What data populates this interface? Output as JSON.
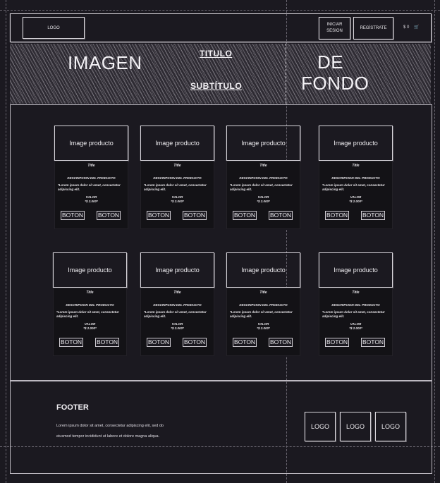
{
  "navbar": {
    "logo": "LOGO",
    "login_label": "INICIAR SESION",
    "register_label": "REGÍSTRATE",
    "cart_text": "$ 0"
  },
  "hero": {
    "left_text": "IMAGEN",
    "right_text_line1": "DE",
    "right_text_line2": "FONDO",
    "title": "TITULO",
    "subtitle": "SUBTÍTULO"
  },
  "products": [
    {
      "image_label": "Image producto",
      "title": "Title",
      "description_heading": "DESCRIPCION DEL PRODUCTO",
      "description": "*Lorem ipsum dolor sit amet, consectetur adipiscing elit.",
      "value_label": "VALOR",
      "price": "*$ 2.000*",
      "button1": "BOTON",
      "button2": "BOTON"
    },
    {
      "image_label": "Image producto",
      "title": "Title",
      "description_heading": "DESCRIPCION DEL PRODUCTO",
      "description": "*Lorem ipsum dolor sit amet, consectetur adipiscing elit.",
      "value_label": "VALOR",
      "price": "*$ 2.000*",
      "button1": "BOTON",
      "button2": "BOTON"
    },
    {
      "image_label": "Image producto",
      "title": "Title",
      "description_heading": "DESCRIPCION DEL PRODUCTO",
      "description": "*Lorem ipsum dolor sit amet, consectetur adipiscing elit.",
      "value_label": "VALOR",
      "price": "*$ 2.000*",
      "button1": "BOTON",
      "button2": "BOTON"
    },
    {
      "image_label": "Image producto",
      "title": "Title",
      "description_heading": "DESCRIPCION DEL PRODUCTO",
      "description": "*Lorem ipsum dolor sit amet, consectetur adipiscing elit.",
      "value_label": "VALOR",
      "price": "*$ 2.000*",
      "button1": "BOTON",
      "button2": "BOTON"
    },
    {
      "image_label": "Image producto",
      "title": "Title",
      "description_heading": "DESCRIPCION DEL PRODUCTO",
      "description": "*Lorem ipsum dolor sit amet, consectetur adipiscing elit.",
      "value_label": "VALOR",
      "price": "*$ 2.000*",
      "button1": "BOTON",
      "button2": "BOTON"
    },
    {
      "image_label": "Image producto",
      "title": "Title",
      "description_heading": "DESCRIPCION DEL PRODUCTO",
      "description": "*Lorem ipsum dolor sit amet, consectetur adipiscing elit.",
      "value_label": "VALOR",
      "price": "*$ 2.000*",
      "button1": "BOTON",
      "button2": "BOTON"
    },
    {
      "image_label": "Image producto",
      "title": "Title",
      "description_heading": "DESCRIPCION DEL PRODUCTO",
      "description": "*Lorem ipsum dolor sit amet, consectetur adipiscing elit.",
      "value_label": "VALOR",
      "price": "*$ 2.000*",
      "button1": "BOTON",
      "button2": "BOTON"
    },
    {
      "image_label": "Image producto",
      "title": "Title",
      "description_heading": "DESCRIPCION DEL PRODUCTO",
      "description": "*Lorem ipsum dolor sit amet, consectetur adipiscing elit.",
      "value_label": "VALOR",
      "price": "*$ 2.000*",
      "button1": "BOTON",
      "button2": "BOTON"
    }
  ],
  "footer": {
    "title": "FOOTER",
    "text": "Lorem ipsum dolor sit amet, consectetur adipiscing elit, sed do eiusmod tempor incididunt ut labore et dolore magna aliqua.",
    "logos": [
      "LOGO",
      "LOGO",
      "LOGO"
    ]
  },
  "colors": {
    "background": "#1b1920",
    "sketch_line": "#d9d6dc",
    "card_body": "#131216"
  }
}
